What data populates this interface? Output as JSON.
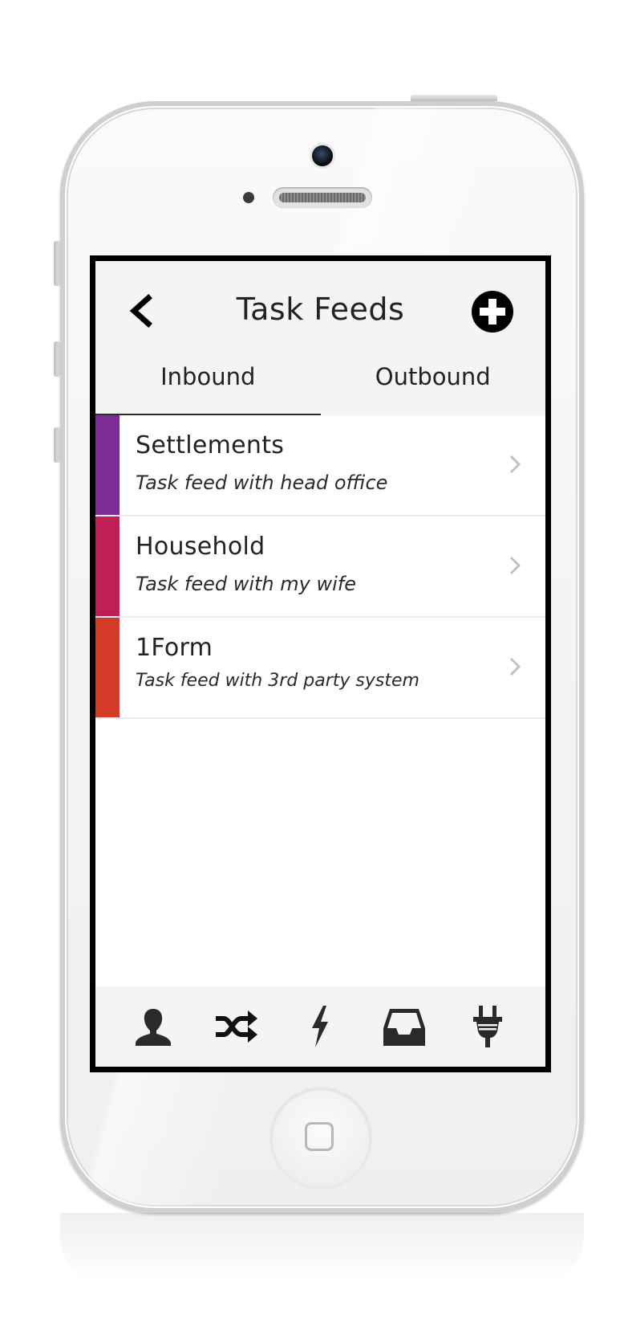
{
  "header": {
    "title": "Task Feeds",
    "back_icon": "chevron-left-icon",
    "add_icon": "plus-circle-icon"
  },
  "tabs": [
    {
      "label": "Inbound",
      "active": true
    },
    {
      "label": "Outbound",
      "active": false
    }
  ],
  "feeds": [
    {
      "name": "Settlements",
      "description": "Task feed with head office",
      "color": "#7b2d95"
    },
    {
      "name": "Household",
      "description": "Task feed with my wife",
      "color": "#c01f55"
    },
    {
      "name": "1Form",
      "description": "Task feed with 3rd party system",
      "color": "#d33a28"
    }
  ],
  "tabbar": {
    "icons": [
      "user-icon",
      "shuffle-icon",
      "lightning-icon",
      "inbox-icon",
      "plug-icon"
    ]
  },
  "colors": {
    "header_bg": "#f3f4f3",
    "text": "#222222",
    "chevron": "#c2c2c2"
  }
}
